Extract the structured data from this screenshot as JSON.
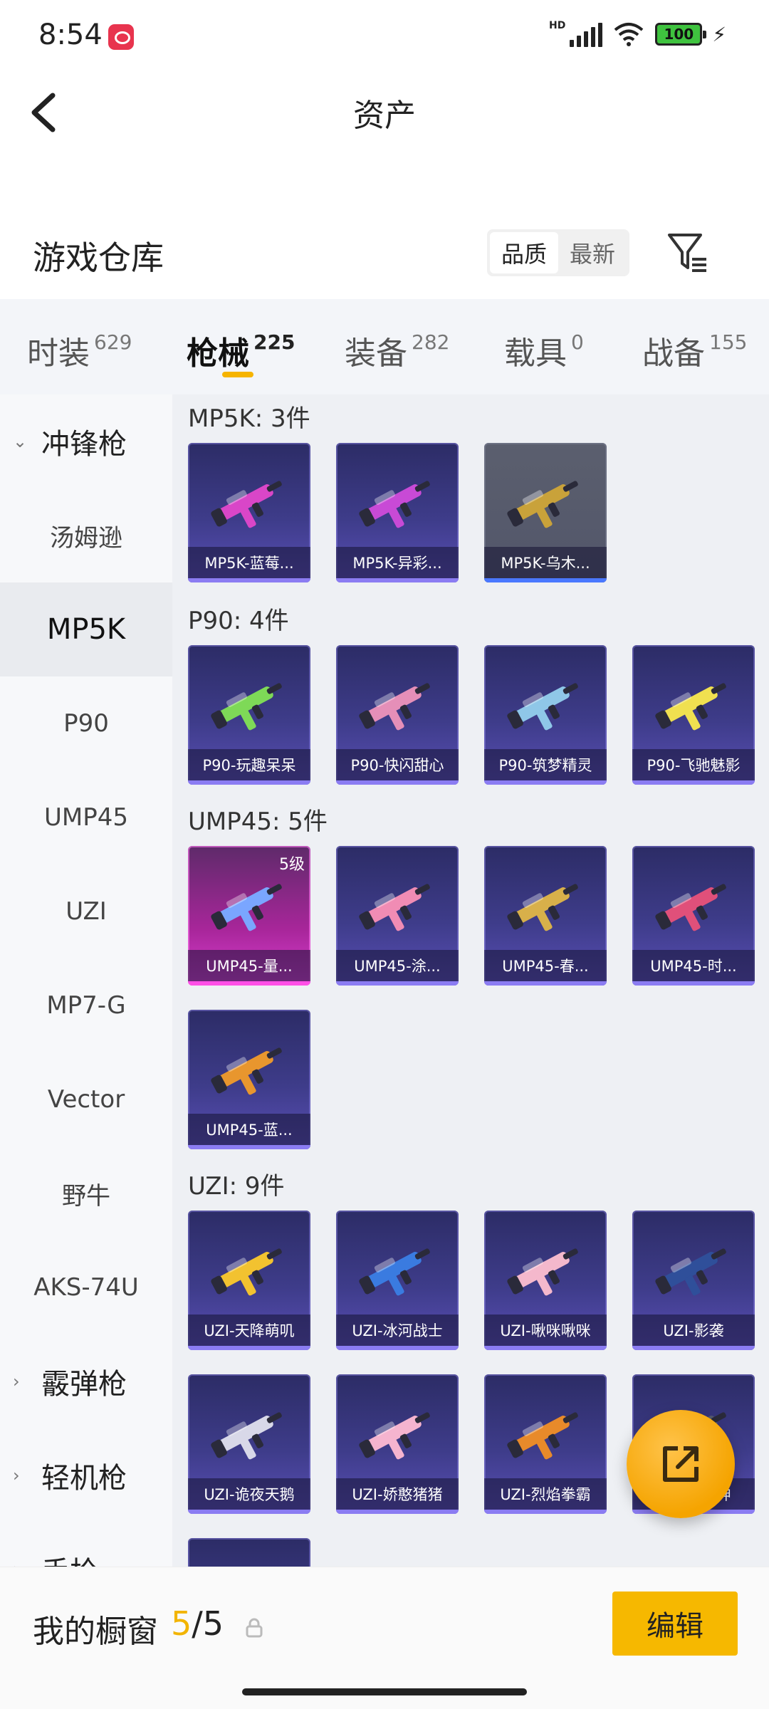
{
  "status_bar": {
    "time": "8:54",
    "battery": "100",
    "network": "HD"
  },
  "header": {
    "title": "资产"
  },
  "warehouse": {
    "title": "游戏仓库",
    "sort_options": [
      "品质",
      "最新"
    ],
    "active_sort": "品质"
  },
  "tabs": [
    {
      "label": "时装",
      "count": "629"
    },
    {
      "label": "枪械",
      "count": "225"
    },
    {
      "label": "装备",
      "count": "282"
    },
    {
      "label": "载具",
      "count": "0"
    },
    {
      "label": "战备",
      "count": "155"
    }
  ],
  "sidebar": {
    "items": [
      {
        "label": "冲锋枪",
        "type": "group",
        "expanded": true
      },
      {
        "label": "汤姆逊",
        "type": "item"
      },
      {
        "label": "MP5K",
        "type": "item",
        "active": true
      },
      {
        "label": "P90",
        "type": "item"
      },
      {
        "label": "UMP45",
        "type": "item"
      },
      {
        "label": "UZI",
        "type": "item"
      },
      {
        "label": "MP7-G",
        "type": "item"
      },
      {
        "label": "Vector",
        "type": "item"
      },
      {
        "label": "野牛",
        "type": "item"
      },
      {
        "label": "AKS-74U",
        "type": "item"
      },
      {
        "label": "霰弹枪",
        "type": "group"
      },
      {
        "label": "轻机枪",
        "type": "group"
      },
      {
        "label": "手枪",
        "type": "group"
      }
    ]
  },
  "sections": [
    {
      "title": "MP5K: 3件",
      "items": [
        {
          "name": "MP5K-蓝莓...",
          "quality": "purple",
          "gun_color": "#d946c8"
        },
        {
          "name": "MP5K-异彩...",
          "quality": "purple",
          "gun_color": "#c84ad6"
        },
        {
          "name": "MP5K-乌木...",
          "quality": "gray",
          "gun_color": "#c9a23a"
        }
      ]
    },
    {
      "title": "P90: 4件",
      "items": [
        {
          "name": "P90-玩趣呆呆",
          "quality": "purple",
          "gun_color": "#7ed957"
        },
        {
          "name": "P90-快闪甜心",
          "quality": "purple",
          "gun_color": "#e58fb8"
        },
        {
          "name": "P90-筑梦精灵",
          "quality": "purple",
          "gun_color": "#8fc7e8"
        },
        {
          "name": "P90-飞驰魅影",
          "quality": "purple",
          "gun_color": "#f0e050"
        }
      ]
    },
    {
      "title": "UMP45: 5件",
      "items": [
        {
          "name": "UMP45-量...",
          "quality": "pink",
          "level": "5级",
          "gun_color": "#7aa6ff"
        },
        {
          "name": "UMP45-涂...",
          "quality": "purple",
          "gun_color": "#f08cb4"
        },
        {
          "name": "UMP45-春...",
          "quality": "purple",
          "gun_color": "#d8b04a"
        },
        {
          "name": "UMP45-时...",
          "quality": "purple",
          "gun_color": "#e0507a"
        },
        {
          "name": "UMP45-蓝...",
          "quality": "purple",
          "gun_color": "#e8962e"
        }
      ]
    },
    {
      "title": "UZI: 9件",
      "items": [
        {
          "name": "UZI-天降萌叽",
          "quality": "purple",
          "gun_color": "#f2c230"
        },
        {
          "name": "UZI-冰河战士",
          "quality": "purple",
          "gun_color": "#3a7be0"
        },
        {
          "name": "UZI-啾咪啾咪",
          "quality": "purple",
          "gun_color": "#f4b8cc"
        },
        {
          "name": "UZI-影袭",
          "quality": "purple",
          "gun_color": "#2f4f9a"
        },
        {
          "name": "UZI-诡夜天鹅",
          "quality": "purple",
          "gun_color": "#d8d8e8"
        },
        {
          "name": "UZI-娇憨猪猪",
          "quality": "purple",
          "gun_color": "#f5b4cf"
        },
        {
          "name": "UZI-烈焰拳霸",
          "quality": "purple",
          "gun_color": "#e88a2a"
        },
        {
          "name": "UZI-...之神",
          "quality": "purple",
          "gun_color": "#555a70"
        },
        {
          "name": "",
          "quality": "purple",
          "gun_color": "#444"
        }
      ]
    }
  ],
  "bottom_bar": {
    "label": "我的橱窗",
    "current": "5",
    "total": "/5",
    "edit_label": "编辑"
  },
  "colors": {
    "accent": "#f6b800",
    "card_purple": "#3e3c8a",
    "card_pink": "#d93fd1"
  }
}
